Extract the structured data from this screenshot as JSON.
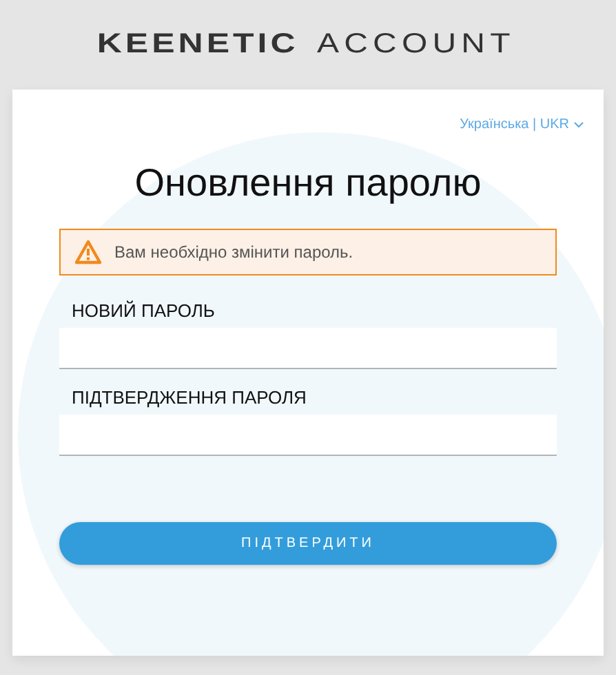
{
  "header": {
    "brand": "KEENETIC",
    "product": "ACCOUNT"
  },
  "language": "Українська | UKR",
  "title": "Оновлення паролю",
  "alert": {
    "kind": "warning",
    "text": "Вам необхідно змінити пароль."
  },
  "fields": [
    {
      "label": "НОВИЙ ПАРОЛЬ"
    },
    {
      "label": "ПІДТВЕРДЖЕННЯ ПАРОЛЯ"
    }
  ],
  "submit_button": "ПІДТВЕРДИТИ"
}
